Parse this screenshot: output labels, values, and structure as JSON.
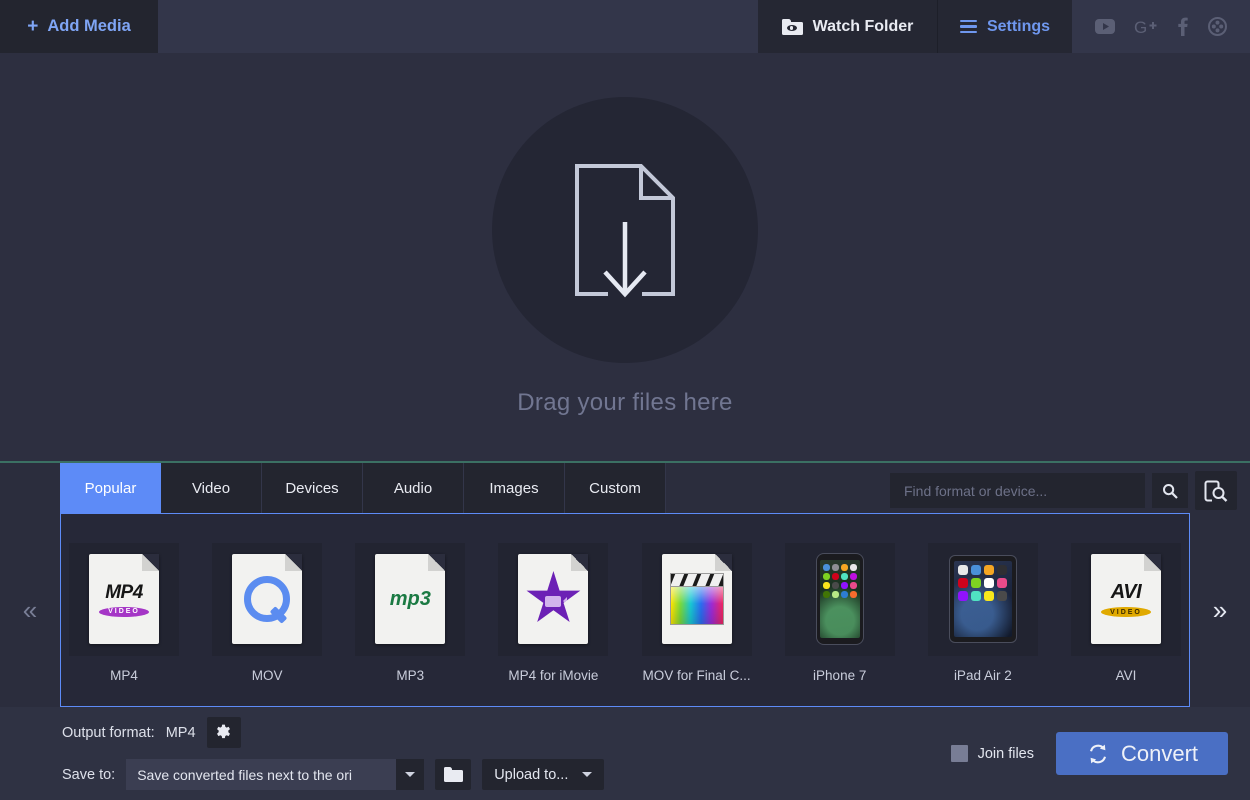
{
  "topbar": {
    "add_media_label": "Add Media",
    "add_media_icon": "plus-icon",
    "watch_folder_label": "Watch Folder",
    "watch_folder_icon": "folder-eye-icon",
    "settings_label": "Settings",
    "settings_icon": "hamburger-icon",
    "social": [
      {
        "name": "youtube-icon",
        "glyph": "▶"
      },
      {
        "name": "google-plus-icon",
        "glyph": "G+"
      },
      {
        "name": "facebook-icon",
        "glyph": "f"
      },
      {
        "name": "film-reel-icon",
        "glyph": "✺"
      }
    ]
  },
  "dropzone": {
    "icon": "document-download-icon",
    "text": "Drag your files here"
  },
  "formats": {
    "tabs": [
      {
        "label": "Popular",
        "active": true
      },
      {
        "label": "Video",
        "active": false
      },
      {
        "label": "Devices",
        "active": false
      },
      {
        "label": "Audio",
        "active": false
      },
      {
        "label": "Images",
        "active": false
      },
      {
        "label": "Custom",
        "active": false
      }
    ],
    "search_placeholder": "Find format or device...",
    "search_value": "",
    "search_icon": "magnifier-icon",
    "device_search_icon": "device-search-icon",
    "prev_arrow": "«",
    "next_arrow": "»",
    "items": [
      {
        "label": "MP4",
        "icon": "mp4-file-icon",
        "badge": "VIDEO"
      },
      {
        "label": "MOV",
        "icon": "quicktime-file-icon"
      },
      {
        "label": "MP3",
        "icon": "mp3-file-icon"
      },
      {
        "label": "MP4 for iMovie",
        "icon": "imovie-star-icon"
      },
      {
        "label": "MOV for Final C...",
        "icon": "final-cut-clapper-icon"
      },
      {
        "label": "iPhone 7",
        "icon": "iphone-device-icon"
      },
      {
        "label": "iPad Air 2",
        "icon": "ipad-device-icon"
      },
      {
        "label": "AVI",
        "icon": "avi-file-icon",
        "badge": "VIDEO"
      }
    ]
  },
  "bottombar": {
    "output_format_label": "Output format:",
    "output_format_value": "MP4",
    "settings_gear_icon": "gear-icon",
    "save_to_label": "Save to:",
    "save_to_value": "Save converted files next to the ori",
    "folder_icon": "folder-icon",
    "upload_to_label": "Upload to...",
    "join_files_label": "Join files",
    "join_files_checked": false,
    "convert_label": "Convert",
    "convert_icon": "refresh-cycle-icon"
  },
  "colors": {
    "accent_blue": "#5d8bf7",
    "convert_blue": "#4a6fc4",
    "panel_dark": "#23252f",
    "background": "#2b2d3d",
    "divider_teal": "#3b7063"
  }
}
